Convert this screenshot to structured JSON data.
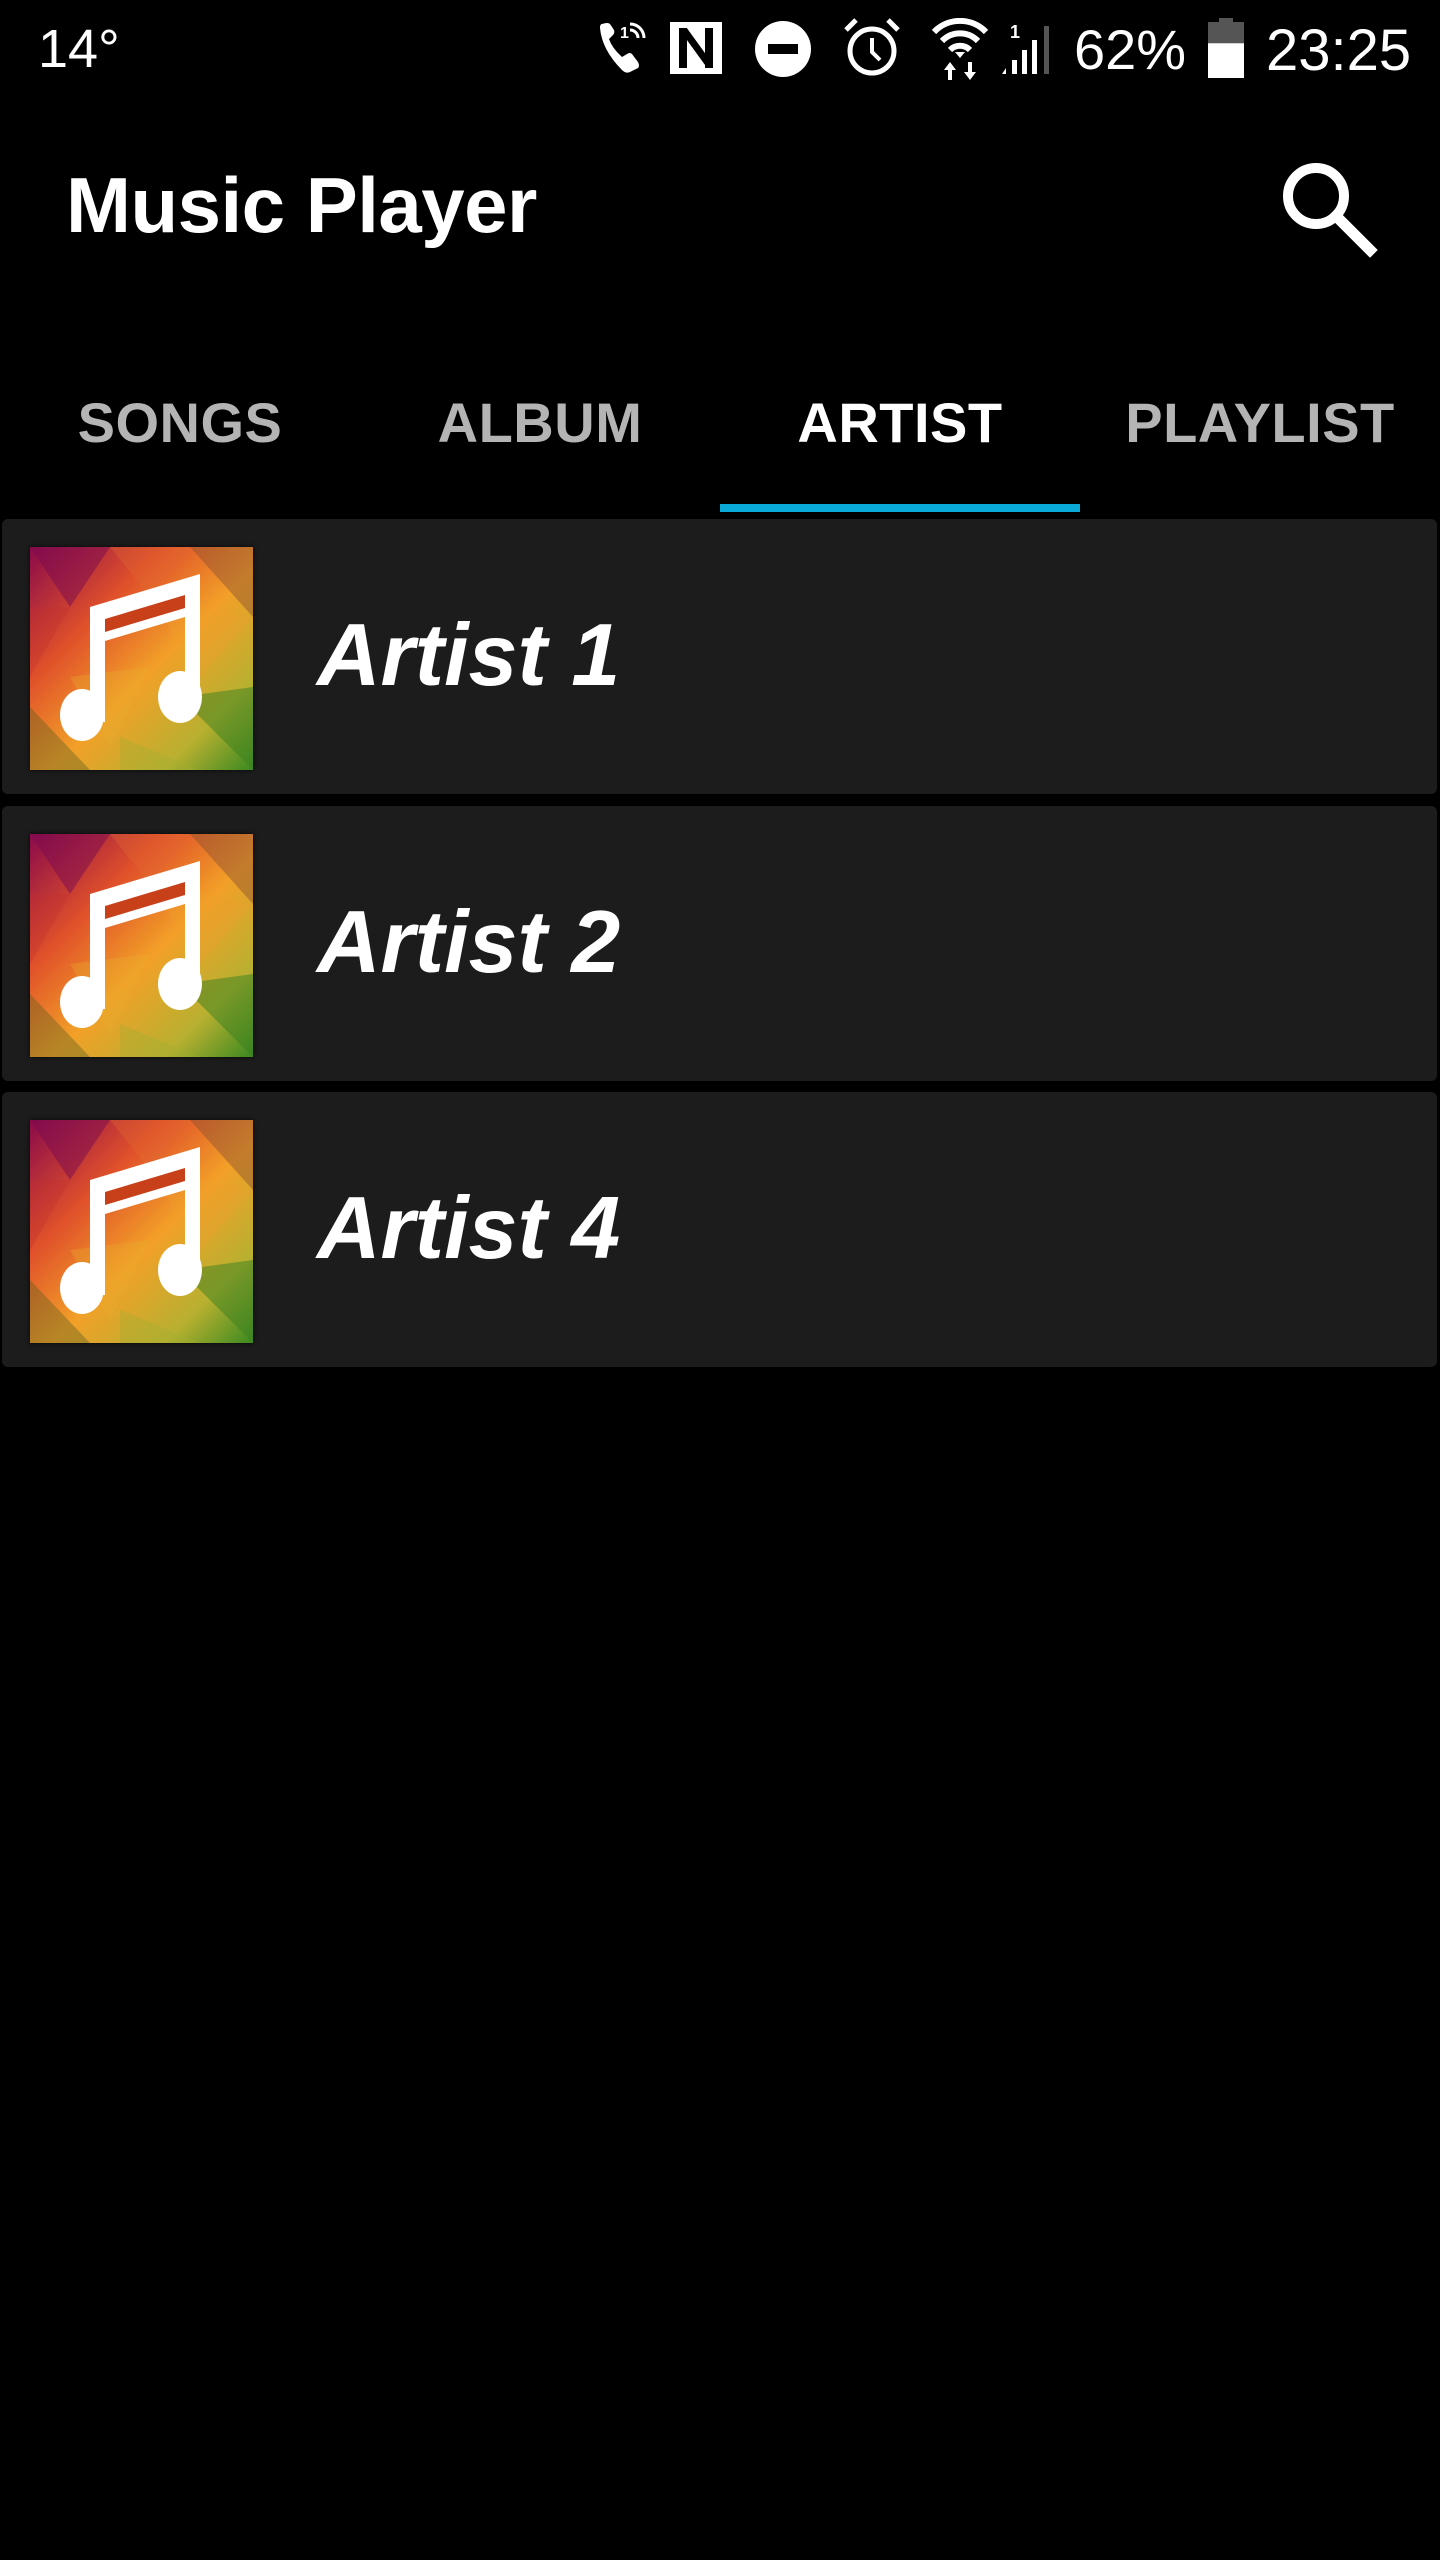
{
  "status_bar": {
    "temperature": "14°",
    "icons": [
      "wifi-calling-icon",
      "nfc-icon",
      "do-not-disturb-icon",
      "alarm-icon",
      "wifi-icon",
      "cellular-signal-icon",
      "battery-icon"
    ],
    "battery_percent": "62%",
    "battery_level": 0.62,
    "time": "23:25"
  },
  "app_bar": {
    "title": "Music Player",
    "search_icon": "search-icon"
  },
  "tabs": [
    {
      "label": "SONGS",
      "active": false
    },
    {
      "label": "ALBUM",
      "active": false
    },
    {
      "label": "ARTIST",
      "active": true
    },
    {
      "label": "PLAYLIST",
      "active": false
    }
  ],
  "colors": {
    "background": "#000000",
    "card": "#1c1c1c",
    "accent": "#0aaad8",
    "tab_inactive": "#b4b4b4",
    "tab_active": "#ffffff"
  },
  "artists": [
    {
      "name": "Artist 1",
      "icon": "music-note-icon"
    },
    {
      "name": "Artist 2",
      "icon": "music-note-icon"
    },
    {
      "name": "Artist 4",
      "icon": "music-note-icon"
    }
  ]
}
